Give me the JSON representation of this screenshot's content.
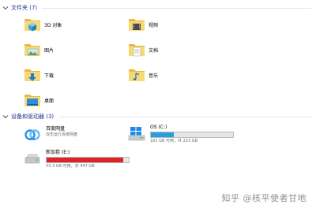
{
  "folders_section": {
    "title": "文件夹 (7)",
    "items": [
      {
        "label": "3D 对象",
        "icon": "3d-objects-folder-icon"
      },
      {
        "label": "视频",
        "icon": "videos-folder-icon"
      },
      {
        "label": "图片",
        "icon": "pictures-folder-icon"
      },
      {
        "label": "文档",
        "icon": "documents-folder-icon"
      },
      {
        "label": "下载",
        "icon": "downloads-folder-icon"
      },
      {
        "label": "音乐",
        "icon": "music-folder-icon"
      },
      {
        "label": "桌面",
        "icon": "desktop-folder-icon"
      }
    ]
  },
  "drives_section": {
    "title": "设备和驱动器 (3)",
    "baidu": {
      "name": "百度网盘",
      "subtitle": "双击运行百度网盘"
    },
    "os_drive": {
      "name": "OS (C:)",
      "usage": "161 GB 可用，共 223 GB",
      "used_fraction": 0.28,
      "bar_color": "#26a0da"
    },
    "new_volume": {
      "name": "新加卷 (E:)",
      "usage": "33.3 GB 可用，共 447 GB",
      "used_fraction": 0.93,
      "bar_color": "#da2626"
    }
  },
  "watermark": "知乎 @核平使者甘地",
  "colors": {
    "section_title": "#1e3287",
    "folder": "#f8d775"
  }
}
